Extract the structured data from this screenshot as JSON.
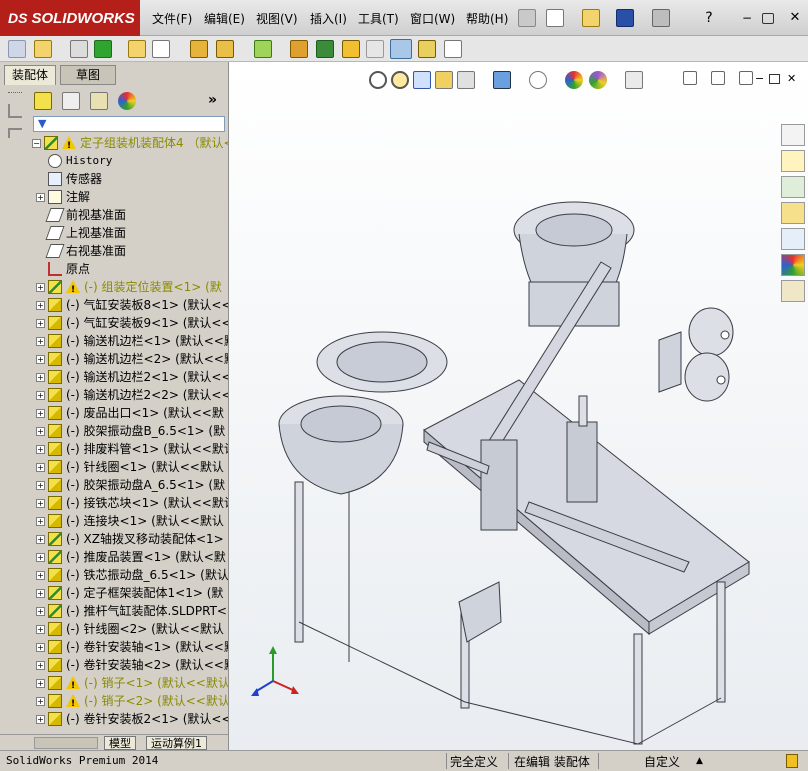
{
  "app": {
    "name": "SOLIDWORKS",
    "status_product": "SolidWorks Premium 2014"
  },
  "menu": [
    "文件(F)",
    "编辑(E)",
    "视图(V)",
    "插入(I)",
    "工具(T)",
    "窗口(W)",
    "帮助(H)"
  ],
  "left_tabs": [
    "装配体",
    "草图"
  ],
  "tree": {
    "root": "定子组装机装配体4 （默认<默",
    "items": [
      {
        "label": "History",
        "mono": true,
        "icon": "history-icon"
      },
      {
        "label": "传感器",
        "icon": "sensor-icon"
      },
      {
        "label": "注解",
        "icon": "annotation-icon",
        "expand": true
      },
      {
        "label": "前视基准面",
        "icon": "plane-icon"
      },
      {
        "label": "上视基准面",
        "icon": "plane-icon"
      },
      {
        "label": "右视基准面",
        "icon": "plane-icon"
      },
      {
        "label": "原点",
        "icon": "origin-icon"
      },
      {
        "label": "(-) 组装定位装置<1> (默",
        "icon": "assembly-icon",
        "warn": true,
        "expand": true,
        "olive": true
      },
      {
        "label": "(-) 气缸安装板8<1> (默认<<",
        "icon": "part-icon",
        "expand": true
      },
      {
        "label": "(-) 气缸安装板9<1> (默认<<",
        "icon": "part-icon",
        "expand": true
      },
      {
        "label": "(-) 输送机边栏<1> (默认<<默",
        "icon": "part-icon",
        "expand": true
      },
      {
        "label": "(-) 输送机边栏<2> (默认<<默",
        "icon": "part-icon",
        "expand": true
      },
      {
        "label": "(-) 输送机边栏2<1> (默认<<",
        "icon": "part-icon",
        "expand": true
      },
      {
        "label": "(-) 输送机边栏2<2> (默认<<",
        "icon": "part-icon",
        "expand": true
      },
      {
        "label": "(-) 废品出口<1> (默认<<默",
        "icon": "part-icon",
        "expand": true
      },
      {
        "label": "(-) 胶架振动盘B_6.5<1> (默",
        "icon": "part-icon",
        "expand": true
      },
      {
        "label": "(-) 排废料管<1> (默认<<默认",
        "icon": "part-icon",
        "expand": true
      },
      {
        "label": "(-) 针线圈<1> (默认<<默认",
        "icon": "part-icon",
        "expand": true
      },
      {
        "label": "(-) 胶架振动盘A_6.5<1> (默",
        "icon": "part-icon",
        "expand": true
      },
      {
        "label": "(-) 接铁芯块<1> (默认<<默认",
        "icon": "part-icon",
        "expand": true
      },
      {
        "label": "(-) 连接块<1> (默认<<默认",
        "icon": "part-icon",
        "expand": true
      },
      {
        "label": "(-) XZ轴拨叉移动装配体<1>",
        "icon": "assembly-icon",
        "expand": true
      },
      {
        "label": "(-) 推废品装置<1> (默认<默",
        "icon": "assembly-icon",
        "expand": true
      },
      {
        "label": "(-) 铁芯振动盘_6.5<1> (默认",
        "icon": "part-icon",
        "expand": true
      },
      {
        "label": "(-) 定子框架装配体1<1> (默",
        "icon": "assembly-icon",
        "expand": true
      },
      {
        "label": "(-) 推杆气缸装配体.SLDPRT<",
        "icon": "assembly-icon",
        "expand": true
      },
      {
        "label": "(-) 针线圈<2> (默认<<默认",
        "icon": "part-icon",
        "expand": true
      },
      {
        "label": "(-) 卷针安装轴<1> (默认<<默",
        "icon": "part-icon",
        "expand": true
      },
      {
        "label": "(-) 卷针安装轴<2> (默认<<默",
        "icon": "part-icon",
        "expand": true
      },
      {
        "label": "(-) 销子<1> (默认<<默认>",
        "icon": "part-icon",
        "warn": true,
        "expand": true,
        "olive": true
      },
      {
        "label": "(-) 销子<2> (默认<<默认>",
        "icon": "part-icon",
        "warn": true,
        "expand": true,
        "olive": true
      },
      {
        "label": "(-) 卷针安装板2<1> (默认<<",
        "icon": "part-icon",
        "expand": true
      }
    ]
  },
  "bottom_tabs": [
    "模型",
    "运动算例1"
  ],
  "status": {
    "fully_defined": "完全定义",
    "editing": "在编辑 装配体",
    "custom": "自定义",
    "caret": "▲"
  },
  "colors": {
    "brand": "#b51f1a",
    "warning": "#f2c600",
    "olive_text": "#8a8a00"
  }
}
